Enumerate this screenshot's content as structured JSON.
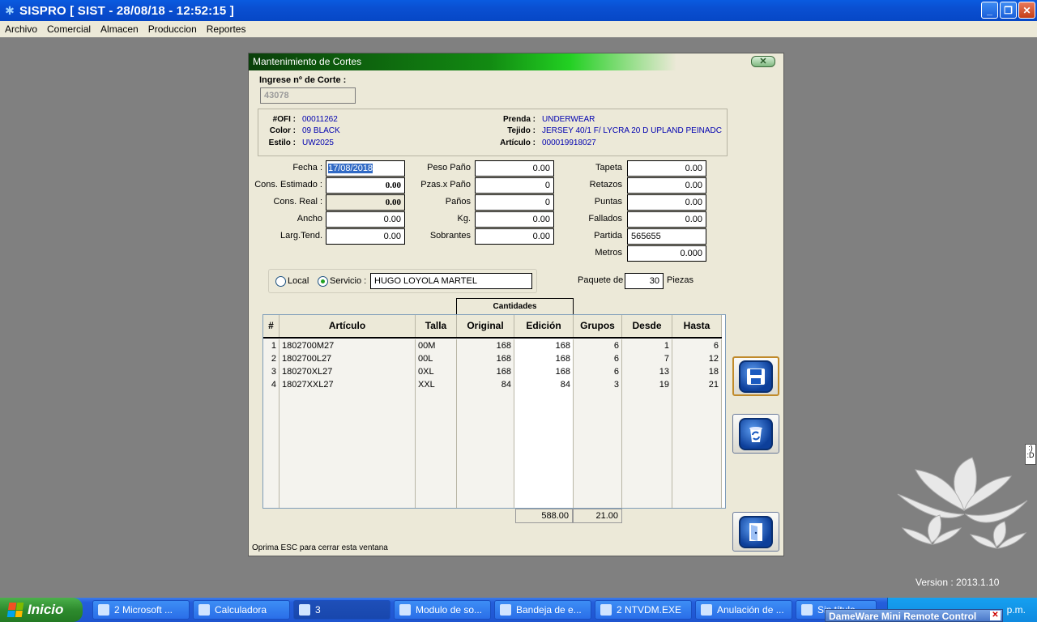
{
  "app": {
    "title": "SISPRO [ SIST - 28/08/18 - 12:52:15 ]"
  },
  "menu": [
    "Archivo",
    "Comercial",
    "Almacen",
    "Produccion",
    "Reportes"
  ],
  "dialog": {
    "title": "Mantenimiento de Cortes",
    "corte_label": "Ingrese nº de Corte :",
    "corte_value": "43078",
    "info": {
      "ofi_label": "#OFI :",
      "ofi": "00011262",
      "color_label": "Color :",
      "color": "09 BLACK",
      "estilo_label": "Estilo :",
      "estilo": "UW2025",
      "prenda_label": "Prenda :",
      "prenda": "UNDERWEAR",
      "tejido_label": "Tejido :",
      "tejido": "JERSEY  40/1 F/ LYCRA 20 D UPLAND  PEINADC",
      "articulo_label": "Artículo :",
      "articulo": "000019918027"
    },
    "fields": {
      "fecha_label": "Fecha :",
      "fecha": "17/08/2018",
      "cons_est_label": "Cons. Estimado :",
      "cons_est": "0.00",
      "cons_real_label": "Cons. Real :",
      "cons_real": "0.00",
      "ancho_label": "Ancho",
      "ancho": "0.00",
      "larg_label": "Larg.Tend.",
      "larg": "0.00",
      "peso_label": "Peso Paño",
      "peso": "0.00",
      "pzas_label": "Pzas.x Paño",
      "pzas": "0",
      "panos_label": "Paños",
      "panos": "0",
      "kg_label": "Kg.",
      "kg": "0.00",
      "sobrantes_label": "Sobrantes",
      "sobrantes": "0.00",
      "tapeta_label": "Tapeta",
      "tapeta": "0.00",
      "retazos_label": "Retazos",
      "retazos": "0.00",
      "puntas_label": "Puntas",
      "puntas": "0.00",
      "fallados_label": "Fallados",
      "fallados": "0.00",
      "partida_label": "Partida",
      "partida": "565655",
      "metros_label": "Metros",
      "metros": "0.000"
    },
    "radio": {
      "local_label": "Local",
      "servicio_label": "Servicio :",
      "servicio_value": "HUGO LOYOLA MARTEL",
      "selected": "servicio"
    },
    "paquete": {
      "label": "Paquete de",
      "value": "30",
      "suffix": "Piezas"
    },
    "grid": {
      "tab_label": "Cantidades",
      "headers": [
        "#",
        "Artículo",
        "Talla",
        "Original",
        "Edición",
        "Grupos",
        "Desde",
        "Hasta"
      ],
      "rows": [
        [
          "1",
          "1802700M27",
          "00M",
          "168",
          "168",
          "6",
          "1",
          "6"
        ],
        [
          "2",
          "1802700L27",
          "00L",
          "168",
          "168",
          "6",
          "7",
          "12"
        ],
        [
          "3",
          "180270XL27",
          "0XL",
          "168",
          "168",
          "6",
          "13",
          "18"
        ],
        [
          "4",
          "18027XXL27",
          "XXL",
          "84",
          "84",
          "3",
          "19",
          "21"
        ]
      ],
      "total_edicion": "588.00",
      "total_grupos": "21.00"
    },
    "footer_hint": "Oprima ESC para cerrar esta ventana"
  },
  "desktop": {
    "version": "Version : 2013.1.10",
    "tooltip_text": ":) :D"
  },
  "taskbar": {
    "start": "Inicio",
    "tasks": [
      "2 Microsoft ...",
      "Calculadora",
      "3",
      "Modulo de so...",
      "Bandeja de e...",
      "2 NTVDM.EXE",
      "Anulación de ...",
      "Sin título"
    ],
    "clock": "p.m.",
    "dameware": "DameWare Mini Remote Control"
  }
}
